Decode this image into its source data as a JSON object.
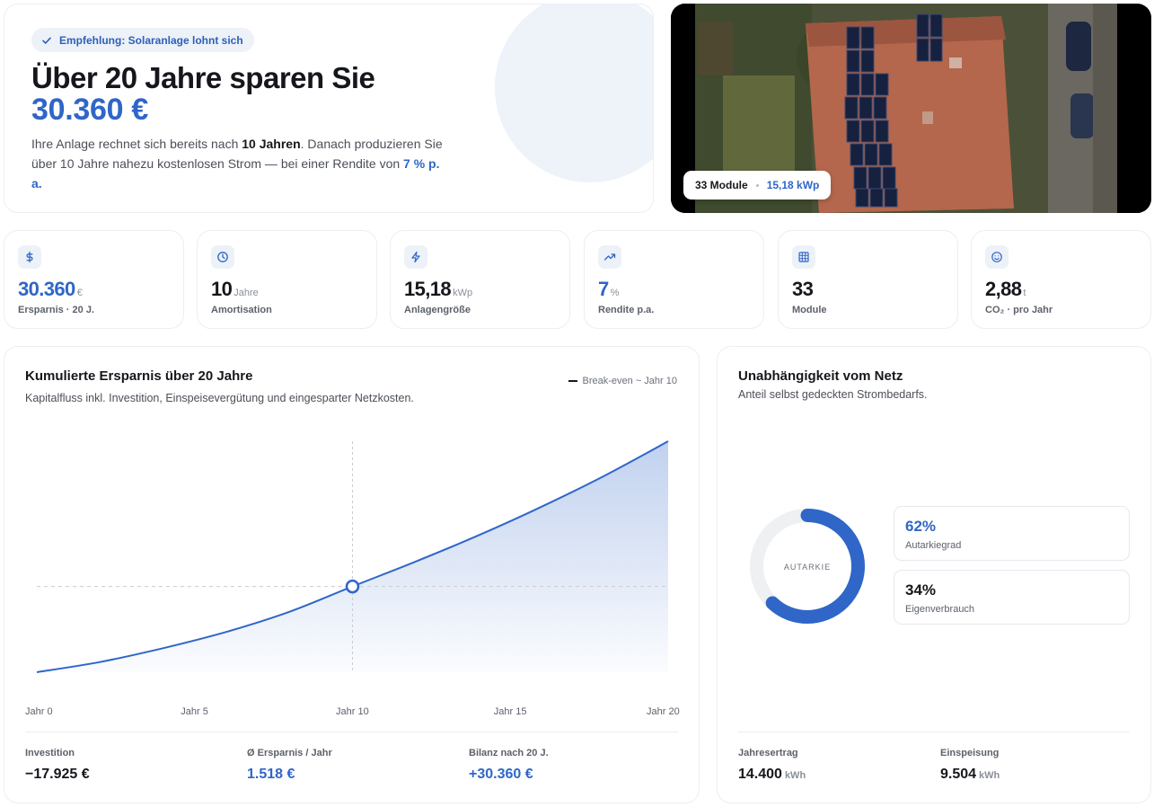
{
  "hero": {
    "badge": "Empfehlung: Solaranlage lohnt sich",
    "title": "Über 20 Jahre sparen Sie",
    "amount": "30.360 €",
    "text_a": "Ihre Anlage rechnet sich bereits nach ",
    "text_b": "10 Jahren",
    "text_c": ". Danach produzieren Sie über 10 Jahre nahezu kostenlosen Strom — bei einer Rendite von ",
    "text_d": "7 % p. a."
  },
  "photo": {
    "modules": "33 Module",
    "kwp": "15,18 kWp"
  },
  "kpis": [
    {
      "icon": "dollar-icon",
      "value": "30.360",
      "unit": "€",
      "label": "Ersparnis · 20 J.",
      "highlight": true
    },
    {
      "icon": "clock-icon",
      "value": "10",
      "unit": "Jahre",
      "label": "Amortisation",
      "highlight": false
    },
    {
      "icon": "bolt-icon",
      "value": "15,18",
      "unit": "kWp",
      "label": "Anlagengröße",
      "highlight": false
    },
    {
      "icon": "trend-up-icon",
      "value": "7",
      "unit": "%",
      "label": "Rendite p.a.",
      "highlight": true
    },
    {
      "icon": "grid-icon",
      "value": "33",
      "unit": "",
      "label": "Module",
      "highlight": false
    },
    {
      "icon": "smile-icon",
      "value": "2,88",
      "unit": "t",
      "label": "CO₂ · pro Jahr",
      "highlight": false
    }
  ],
  "savings_chart": {
    "title": "Kumulierte Ersparnis über 20 Jahre",
    "subtitle": "Kapitalfluss inkl. Investition, Einspeisevergütung und eingesparter Netzkosten.",
    "legend": "Break-even ~ Jahr  10",
    "stats": [
      {
        "label": "Investition",
        "value": "−17.925 €",
        "blue": false
      },
      {
        "label": "Ø Ersparnis / Jahr",
        "value": "1.518 €",
        "blue": true
      },
      {
        "label": "Bilanz nach 20 J.",
        "value": "+30.360 €",
        "blue": true
      }
    ]
  },
  "chart_data": {
    "type": "area",
    "x": [
      0,
      2,
      4,
      6,
      8,
      10,
      12,
      14,
      16,
      18,
      20
    ],
    "y": [
      -17925,
      -15800,
      -12900,
      -9500,
      -5300,
      0,
      5200,
      10700,
      16700,
      23200,
      30360
    ],
    "tick_labels": [
      "Jahr 0",
      "Jahr 5",
      "Jahr 10",
      "Jahr 15",
      "Jahr 20"
    ],
    "tick_values": [
      0,
      5,
      10,
      15,
      20
    ],
    "break_even_x": 10,
    "xlim": [
      0,
      20
    ],
    "ylim": [
      -17925,
      30360
    ],
    "color": "#2f66c8",
    "grid": false
  },
  "net": {
    "title": "Unabhängigkeit vom Netz",
    "subtitle": "Anteil selbst gedeckten Strombedarfs.",
    "donut_label": "AUTARKIE",
    "autarky_fraction": 0.62,
    "autarky_value": "62%",
    "autarky_label": "Autarkiegrad",
    "self_value": "34%",
    "self_label": "Eigenverbrauch",
    "yield_label": "Jahresertrag",
    "yield_value": "14.400",
    "yield_unit": "kWh",
    "feed_label": "Einspeisung",
    "feed_value": "9.504",
    "feed_unit": "kWh"
  }
}
